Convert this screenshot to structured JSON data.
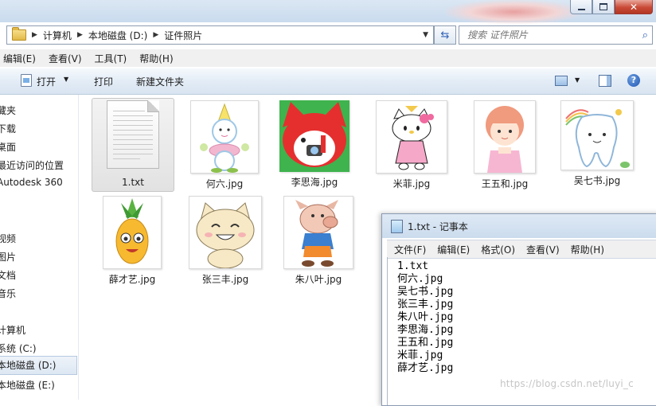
{
  "explorer": {
    "breadcrumb": [
      "计算机",
      "本地磁盘 (D:)",
      "证件照片"
    ],
    "search_placeholder": "搜索 证件照片",
    "menu": [
      "编辑(E)",
      "查看(V)",
      "工具(T)",
      "帮助(H)"
    ],
    "toolbar": {
      "open_label": "打开",
      "print_label": "打印",
      "new_folder_label": "新建文件夹"
    },
    "nav": [
      "藏夹",
      "下载",
      "桌面",
      "最近访问的位置",
      "Autodesk 360",
      "视频",
      "图片",
      "文档",
      "音乐",
      "计算机",
      "系统 (C:)",
      "本地磁盘 (D:)",
      "本地磁盘 (E:)"
    ],
    "files": [
      "1.txt",
      "何六.jpg",
      "李思海.jpg",
      "米菲.jpg",
      "王五和.jpg",
      "吴七书.jpg",
      "薛才艺.jpg",
      "张三丰.jpg",
      "朱八叶.jpg"
    ]
  },
  "notepad": {
    "title": "1.txt - 记事本",
    "menu": [
      "文件(F)",
      "编辑(E)",
      "格式(O)",
      "查看(V)",
      "帮助(H)"
    ],
    "lines": [
      "1.txt",
      "何六.jpg",
      "吴七书.jpg",
      "张三丰.jpg",
      "朱八叶.jpg",
      "李思海.jpg",
      "王五和.jpg",
      "米菲.jpg",
      "薛才艺.jpg"
    ]
  },
  "watermark": "https://blog.csdn.net/luyi_c",
  "colors": {
    "accent": "#2f62b7",
    "close_button": "#c94a36",
    "toolbar_bg": "#e3ecf6"
  }
}
